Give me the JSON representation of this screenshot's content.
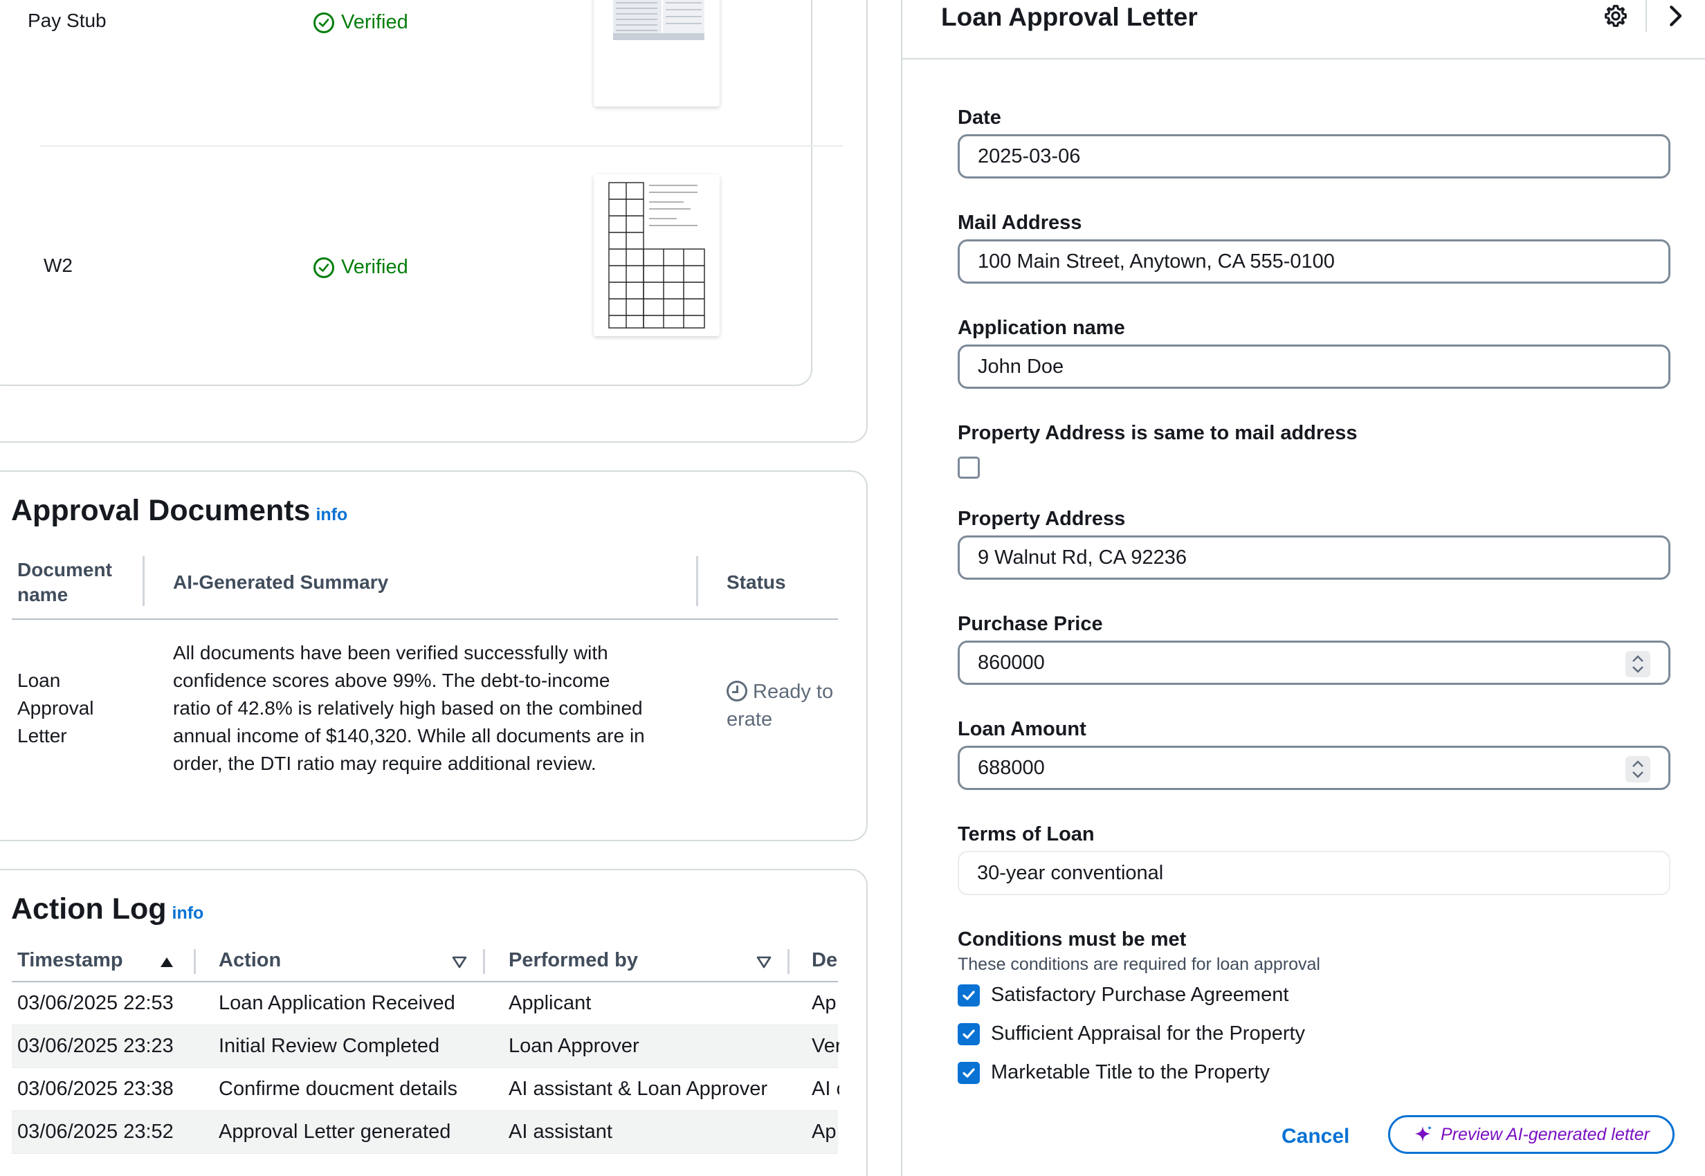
{
  "documents": {
    "rows": [
      {
        "name": "Pay Stub",
        "status": "Verified"
      },
      {
        "name": "W2",
        "status": "Verified"
      }
    ]
  },
  "approval_documents": {
    "title": "Approval Documents",
    "info": "info",
    "headers": [
      "Document name",
      "AI-Generated Summary",
      "Status"
    ],
    "header_doc_line1": "Document",
    "header_doc_line2": "name",
    "row": {
      "name_lines": [
        "Loan",
        "Approval",
        "Letter"
      ],
      "summary_lines": [
        "All documents have been verified successfully with",
        "confidence scores above 99%. The debt-to-income",
        "ratio of 42.8% is relatively high based on the combined",
        "annual income of $140,320. While all documents are in",
        "order, the DTI ratio may require additional review."
      ],
      "status_line1": "Ready to",
      "status_line2": "erate"
    }
  },
  "action_log": {
    "title": "Action Log",
    "info": "info",
    "headers": {
      "timestamp": "Timestamp",
      "action": "Action",
      "performed_by": "Performed by",
      "details": "De"
    },
    "rows": [
      {
        "timestamp": "03/06/2025 22:53",
        "action": "Loan Application Received",
        "performed_by": "Applicant",
        "details": "Ap"
      },
      {
        "timestamp": "03/06/2025 23:23",
        "action": "Initial Review Completed",
        "performed_by": "Loan Approver",
        "details": "Ver"
      },
      {
        "timestamp": "03/06/2025 23:38",
        "action": "Confirme doucment details",
        "performed_by": "AI assistant & Loan Approver",
        "details": "AI c"
      },
      {
        "timestamp": "03/06/2025 23:52",
        "action": "Approval Letter generated",
        "performed_by": "AI assistant",
        "details": "Ap"
      }
    ]
  },
  "panel": {
    "title": "Loan Approval Letter",
    "fields": {
      "date": {
        "label": "Date",
        "value": "2025-03-06"
      },
      "mail_address": {
        "label": "Mail Address",
        "value": "100 Main Street, Anytown, CA 555-0100"
      },
      "application_name": {
        "label": "Application name",
        "value": "John Doe"
      },
      "same_address": {
        "label": "Property Address is same to mail address",
        "checked": false
      },
      "property_address": {
        "label": "Property Address",
        "value": "9 Walnut Rd, CA 92236"
      },
      "purchase_price": {
        "label": "Purchase Price",
        "value": "860000"
      },
      "loan_amount": {
        "label": "Loan Amount",
        "value": "688000"
      },
      "terms_of_loan": {
        "label": "Terms of Loan",
        "value": "30-year conventional"
      }
    },
    "conditions": {
      "label": "Conditions must be met",
      "description": "These conditions are required for loan approval",
      "items": [
        {
          "label": "Satisfactory Purchase Agreement",
          "checked": true
        },
        {
          "label": "Sufficient Appraisal for the Property",
          "checked": true
        },
        {
          "label": "Marketable Title to the Property",
          "checked": true
        }
      ]
    },
    "buttons": {
      "cancel": "Cancel",
      "preview": "Preview AI-generated letter"
    }
  },
  "colors": {
    "verified_green": "#037f0c",
    "link_blue": "#0972d3",
    "ai_purple": "#7a10c2",
    "border_gray": "#7d8998"
  },
  "icons": [
    "check-circle-icon",
    "clock-icon",
    "sort-ascending-icon",
    "filter-caret-icon",
    "gear-icon",
    "chevron-right-icon",
    "drag-handle-icon",
    "stepper-icon",
    "checkbox-checked-icon",
    "sparkle-icon"
  ]
}
